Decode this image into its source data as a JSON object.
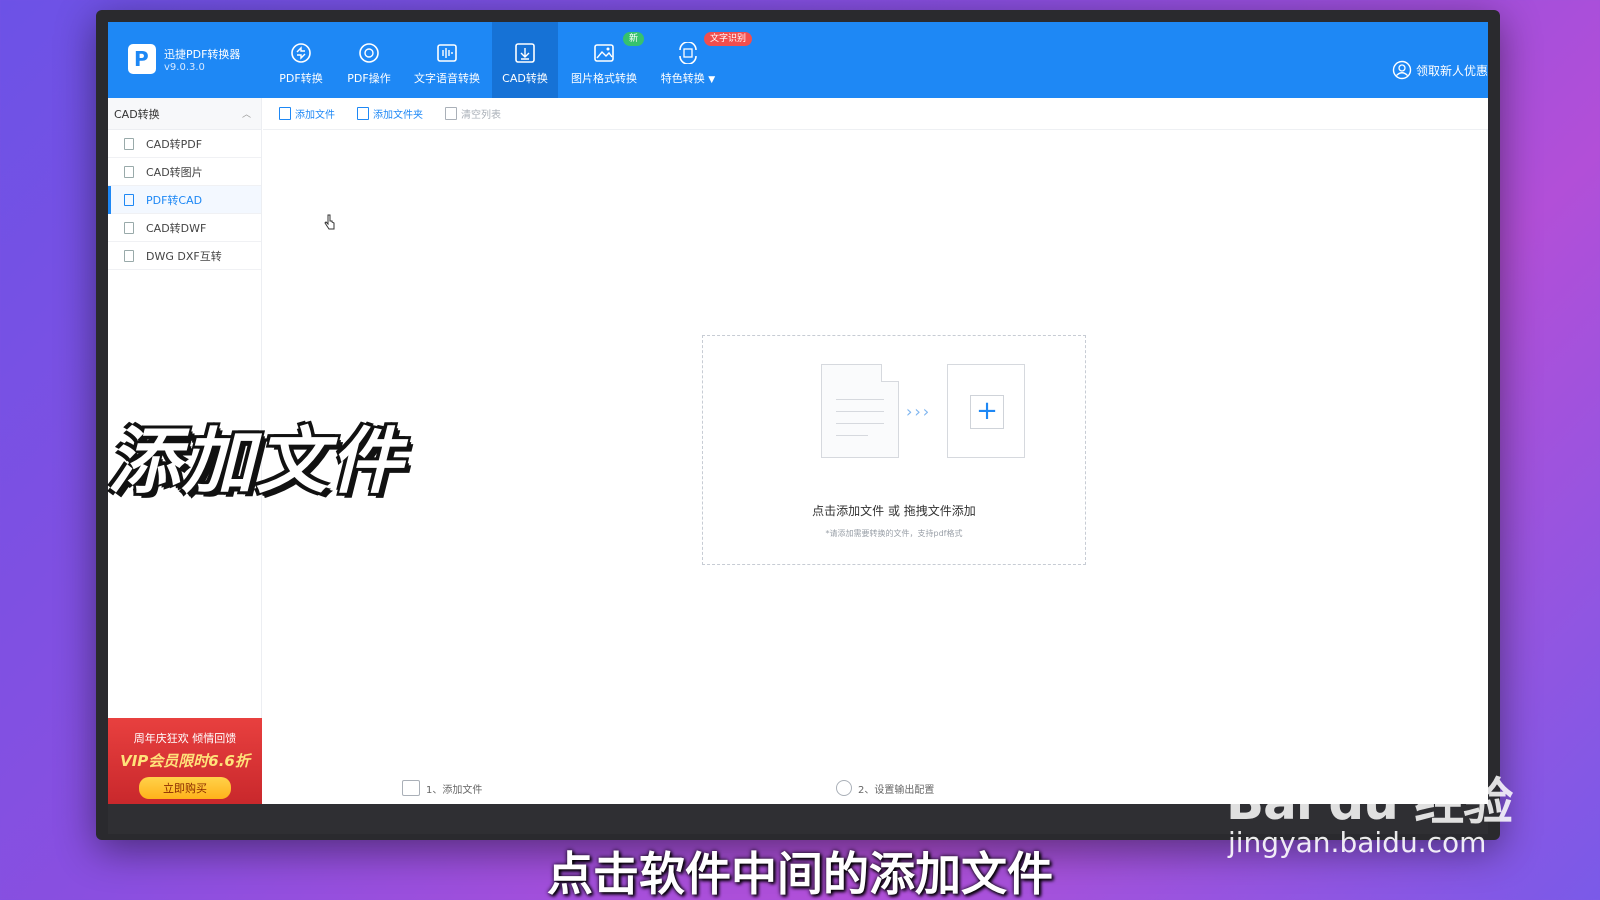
{
  "app": {
    "name": "迅捷PDF转换器",
    "version": "v9.0.3.0"
  },
  "nav": [
    {
      "label": "PDF转换",
      "icon": "pdf-convert-icon"
    },
    {
      "label": "PDF操作",
      "icon": "pdf-operate-icon"
    },
    {
      "label": "文字语音转换",
      "icon": "audio-wave-icon"
    },
    {
      "label": "CAD转换",
      "icon": "cad-convert-icon",
      "active": true
    },
    {
      "label": "图片格式转换",
      "icon": "image-icon",
      "badge": "新"
    },
    {
      "label": "特色转换",
      "icon": "special-convert-icon",
      "badge": "文字识别",
      "dropdown": true
    }
  ],
  "header_right": {
    "coupon_label": "领取新人优惠"
  },
  "sidebar": {
    "title": "CAD转换",
    "items": [
      {
        "label": "CAD转PDF"
      },
      {
        "label": "CAD转图片"
      },
      {
        "label": "PDF转CAD",
        "active": true
      },
      {
        "label": "CAD转DWF"
      },
      {
        "label": "DWG DXF互转"
      }
    ]
  },
  "promo": {
    "line1": "周年庆狂欢 倾情回馈",
    "line2": "VIP会员限时6.6折",
    "button": "立即购买"
  },
  "toolbar": {
    "add_file": "添加文件",
    "add_folder": "添加文件夹",
    "clear_list": "清空列表"
  },
  "dropzone": {
    "main_text": "点击添加文件 或 拖拽文件添加",
    "hint": "*请添加需要转换的文件，支持pdf格式"
  },
  "steps": [
    {
      "label": "1、添加文件"
    },
    {
      "label": "2、设置输出配置"
    }
  ],
  "overlay": {
    "title": "添加文件",
    "subtitle": "点击软件中间的添加文件"
  },
  "watermark": {
    "logo": "Bai du 经验",
    "url": "jingyan.baidu.com"
  },
  "colors": {
    "brand_blue": "#1e88f5",
    "promo_red": "#e8403f",
    "badge_green": "#36c26e",
    "badge_red": "#f24e4e"
  }
}
